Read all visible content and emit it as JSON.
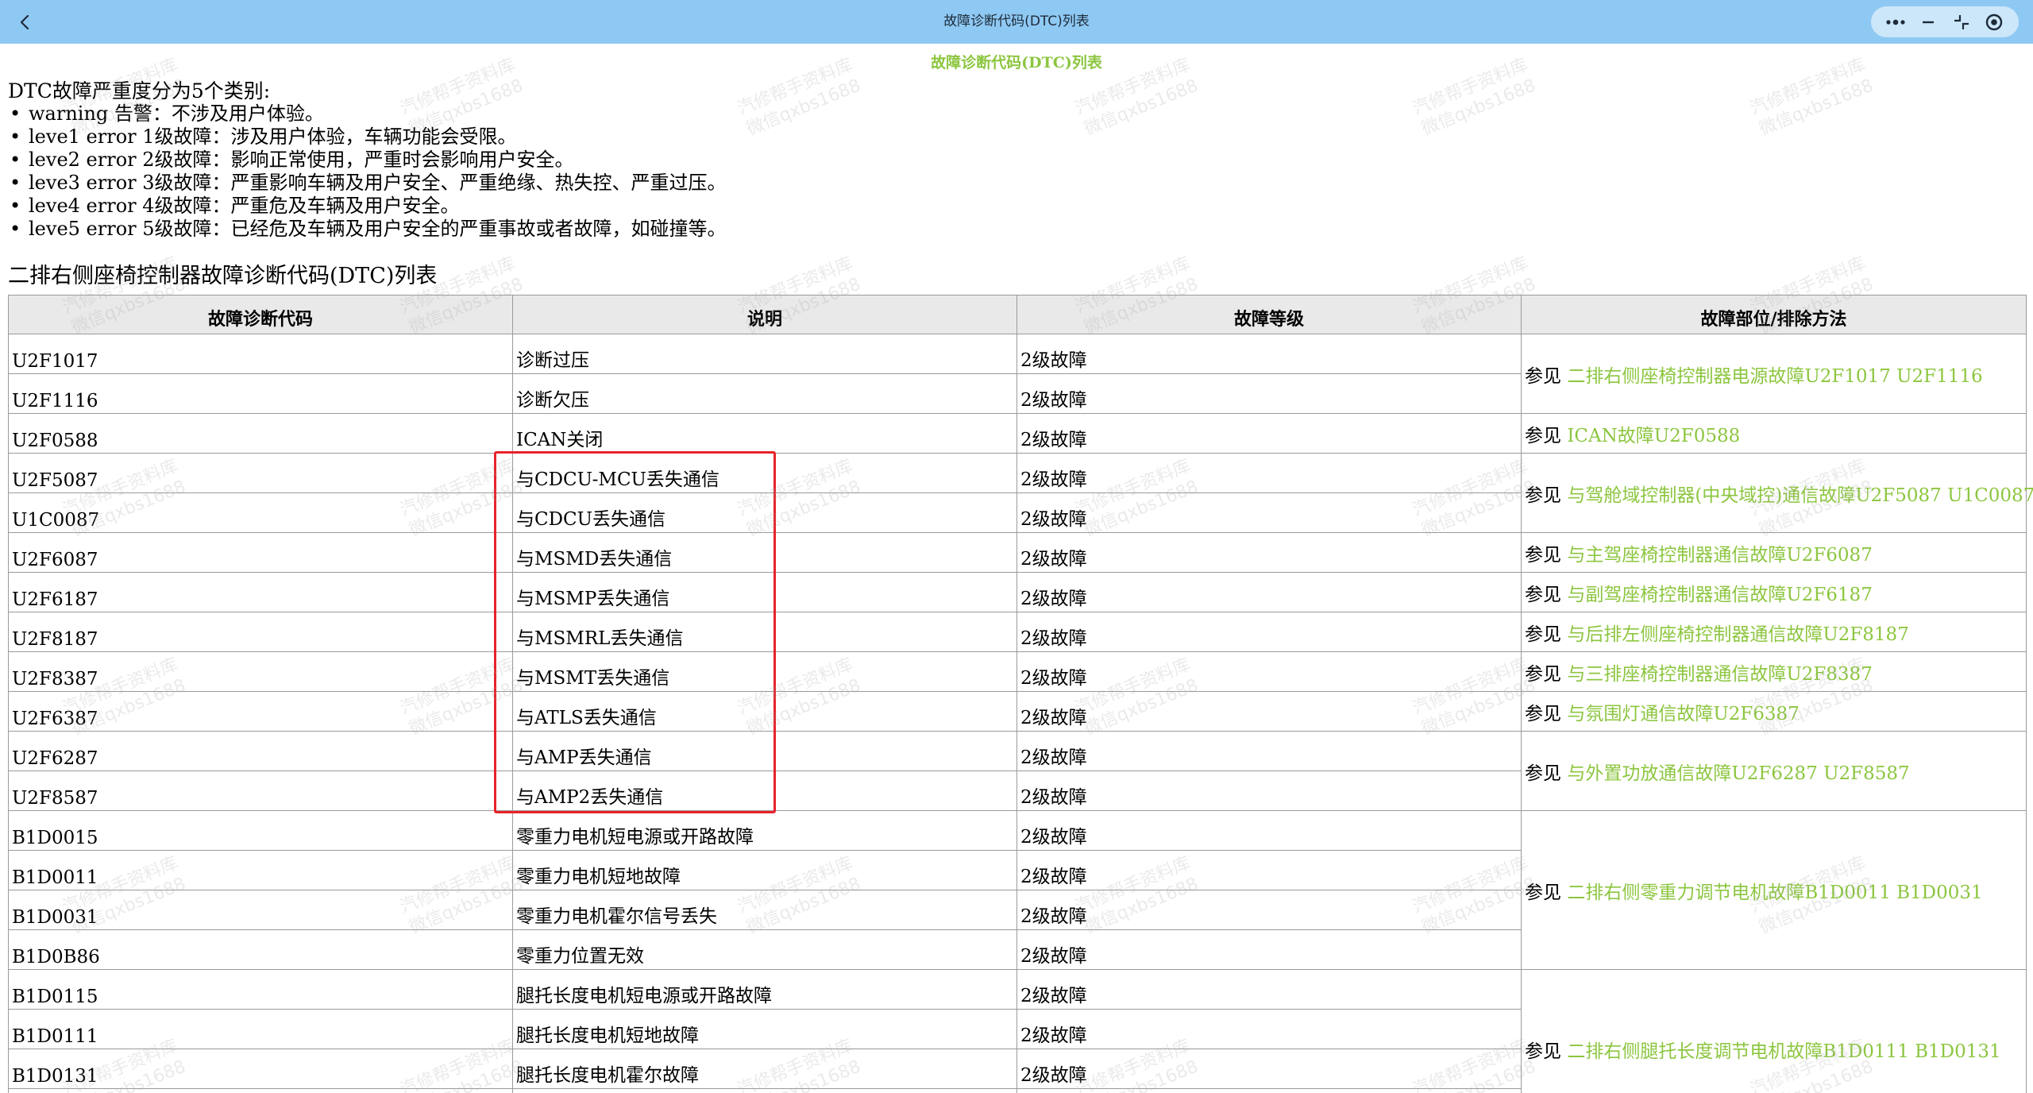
{
  "window": {
    "title": "故障诊断代码(DTC)列表"
  },
  "page": {
    "heading": "故障诊断代码(DTC)列表"
  },
  "intro": {
    "title": "DTC故障严重度分为5个类别:",
    "items": [
      "warning 告警：不涉及用户体验。",
      "leve1 error 1级故障：涉及用户体验，车辆功能会受限。",
      "leve2 error 2级故障：影响正常使用，严重时会影响用户安全。",
      "leve3 error 3级故障：严重影响车辆及用户安全、严重绝缘、热失控、严重过压。",
      "leve4 error 4级故障：严重危及车辆及用户安全。",
      "leve5 error 5级故障：已经危及车辆及用户安全的严重事故或者故障，如碰撞等。"
    ]
  },
  "table": {
    "caption": "二排右侧座椅控制器故障诊断代码(DTC)列表",
    "headers": [
      "故障诊断代码",
      "说明",
      "故障等级",
      "故障部位/排除方法"
    ],
    "ref_prefix": "参见",
    "rows": [
      {
        "code": "U2F1017",
        "desc": "诊断过压",
        "level": "2级故障"
      },
      {
        "code": "U2F1116",
        "desc": "诊断欠压",
        "level": "2级故障"
      },
      {
        "code": "U2F0588",
        "desc": "ICAN关闭",
        "level": "2级故障"
      },
      {
        "code": "U2F5087",
        "desc": "与CDCU-MCU丢失通信",
        "level": "2级故障"
      },
      {
        "code": "U1C0087",
        "desc": "与CDCU丢失通信",
        "level": "2级故障"
      },
      {
        "code": "U2F6087",
        "desc": "与MSMD丢失通信",
        "level": "2级故障"
      },
      {
        "code": "U2F6187",
        "desc": "与MSMP丢失通信",
        "level": "2级故障"
      },
      {
        "code": "U2F8187",
        "desc": "与MSMRL丢失通信",
        "level": "2级故障"
      },
      {
        "code": "U2F8387",
        "desc": "与MSMT丢失通信",
        "level": "2级故障"
      },
      {
        "code": "U2F6387",
        "desc": "与ATLS丢失通信",
        "level": "2级故障"
      },
      {
        "code": "U2F6287",
        "desc": "与AMP丢失通信",
        "level": "2级故障"
      },
      {
        "code": "U2F8587",
        "desc": "与AMP2丢失通信",
        "level": "2级故障"
      },
      {
        "code": "B1D0015",
        "desc": "零重力电机短电源或开路故障",
        "level": "2级故障"
      },
      {
        "code": "B1D0011",
        "desc": "零重力电机短地故障",
        "level": "2级故障"
      },
      {
        "code": "B1D0031",
        "desc": "零重力电机霍尔信号丢失",
        "level": "2级故障"
      },
      {
        "code": "B1D0B86",
        "desc": "零重力位置无效",
        "level": "2级故障"
      },
      {
        "code": "B1D0115",
        "desc": "腿托长度电机短电源或开路故障",
        "level": "2级故障"
      },
      {
        "code": "B1D0111",
        "desc": "腿托长度电机短地故障",
        "level": "2级故障"
      },
      {
        "code": "B1D0131",
        "desc": "腿托长度电机霍尔故障",
        "level": "2级故障"
      }
    ],
    "refs": [
      {
        "text": "二排右侧座椅控制器电源故障U2F1017 U2F1116"
      },
      {
        "text": "ICAN故障U2F0588"
      },
      {
        "text": "与驾舱域控制器(中央域控)通信故障U2F5087 U1C0087"
      },
      {
        "text": "与主驾座椅控制器通信故障U2F6087"
      },
      {
        "text": "与副驾座椅控制器通信故障U2F6187"
      },
      {
        "text": "与后排左侧座椅控制器通信故障U2F8187"
      },
      {
        "text": "与三排座椅控制器通信故障U2F8387"
      },
      {
        "text": "与氛围灯通信故障U2F6387"
      },
      {
        "text": "与外置功放通信故障U2F6287 U2F8587"
      },
      {
        "text": "二排右侧零重力调节电机故障B1D0011 B1D0031"
      },
      {
        "text": "二排右侧腿托长度调节电机故障B1D0111 B1D0131"
      }
    ]
  },
  "watermark": {
    "line1": "汽修帮手资料库",
    "line2": "微信qxbs1688"
  },
  "icons": {
    "back": "chevron-left-icon",
    "more": "more-dots-icon",
    "minimize": "minimize-icon",
    "collapse": "collapse-icon",
    "close": "close-target-icon"
  },
  "colors": {
    "topbar": "#8ec9f3",
    "link": "#8cc63f",
    "highlight": "#e8232a"
  }
}
